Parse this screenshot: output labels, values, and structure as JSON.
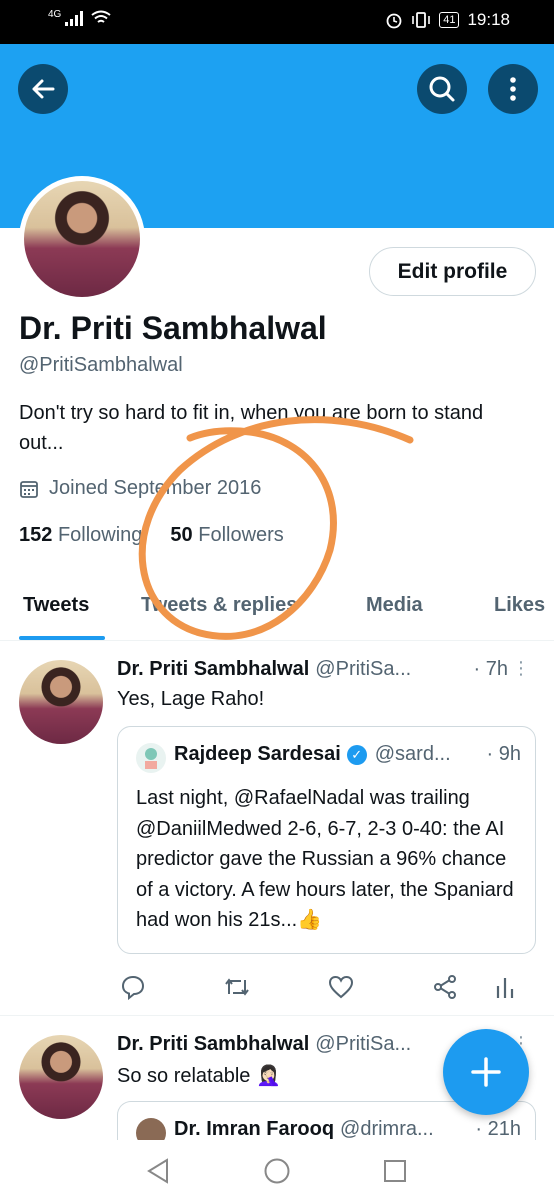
{
  "status_bar": {
    "network": "4G",
    "battery": "41",
    "time": "19:18"
  },
  "profile": {
    "name": "Dr. Priti Sambhalwal",
    "handle": "@PritiSambhalwal",
    "edit_label": "Edit profile",
    "bio": "Don't try so hard to fit in, when you are born to stand out...",
    "joined": "Joined September 2016",
    "following_count": "152",
    "following_label": "Following",
    "followers_count": "50",
    "followers_label": "Followers"
  },
  "tabs": [
    {
      "label": "Tweets",
      "active": true
    },
    {
      "label": "Tweets & replies"
    },
    {
      "label": "Media"
    },
    {
      "label": "Likes"
    }
  ],
  "tweets": [
    {
      "author": "Dr. Priti Sambhalwal",
      "handle": "@PritiSa...",
      "time": "· 7h",
      "text": "Yes, Lage Raho!",
      "quote": {
        "author": "Rajdeep Sardesai",
        "handle": "@sard...",
        "time": "· 9h",
        "text": "Last night, @RafaelNadal was trailing @DaniilMedwed 2-6, 6-7, 2-3 0-40: the AI predictor gave the Russian a 96% chance of a victory. A few hours later, the Spaniard had won his 21s...👍"
      }
    },
    {
      "author": "Dr. Priti Sambhalwal",
      "handle": "@PritiSa...",
      "time": "",
      "text": "So so relatable 🤦🏻‍♀️",
      "quote": {
        "author": "Dr. Imran Farooq",
        "handle": "@drimra...",
        "time": "· 21h"
      }
    }
  ],
  "colors": {
    "accent": "#1d9bf0",
    "banner": "#1da1f2",
    "annotation": "#f0954a"
  }
}
